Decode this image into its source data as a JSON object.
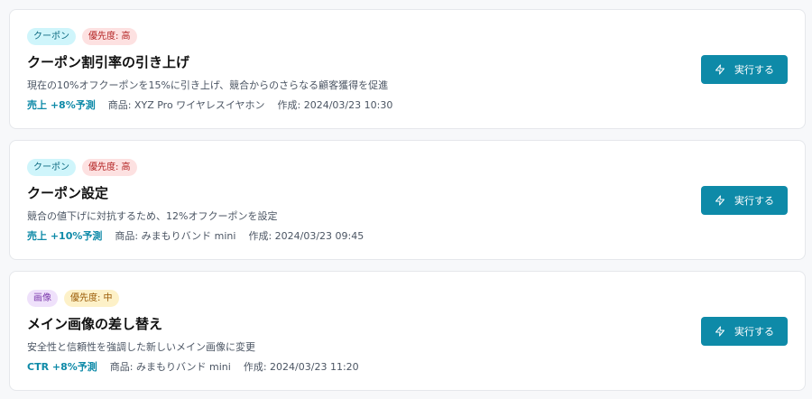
{
  "colors": {
    "accent": "#0e8aa8",
    "coupon_tag_bg": "#cff5fb",
    "image_tag_bg": "#efe1fb",
    "priority_high_bg": "#fde1e1",
    "priority_mid_bg": "#fdf1c8"
  },
  "action_icon": "lightning-icon",
  "cards": [
    {
      "category": "クーポン",
      "priority": "優先度: 高",
      "title": "クーポン割引率の引き上げ",
      "description": "現在の10%オフクーポンを15%に引き上げ、競合からのさらなる顧客獲得を促進",
      "impact": "売上 +8%予測",
      "product": "商品: XYZ Pro ワイヤレスイヤホン",
      "created": "作成: 2024/03/23 10:30",
      "button_label": "実行する"
    },
    {
      "category": "クーポン",
      "priority": "優先度: 高",
      "title": "クーポン設定",
      "description": "競合の値下げに対抗するため、12%オフクーポンを設定",
      "impact": "売上 +10%予測",
      "product": "商品: みまもりバンド mini",
      "created": "作成: 2024/03/23 09:45",
      "button_label": "実行する"
    },
    {
      "category": "画像",
      "priority": "優先度: 中",
      "title": "メイン画像の差し替え",
      "description": "安全性と信頼性を強調した新しいメイン画像に変更",
      "impact": "CTR +8%予測",
      "product": "商品: みまもりバンド mini",
      "created": "作成: 2024/03/23 11:20",
      "button_label": "実行する"
    }
  ]
}
